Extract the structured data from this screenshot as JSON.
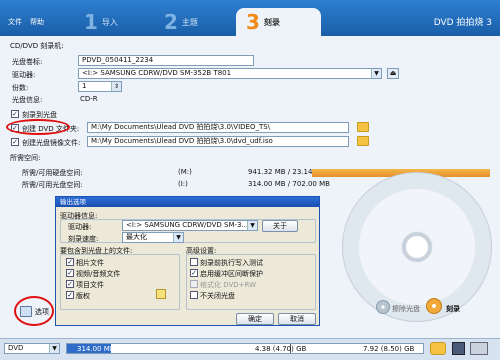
{
  "menu": {
    "file": "文件",
    "help": "帮助"
  },
  "tabs": [
    {
      "num": "1",
      "label": "导入"
    },
    {
      "num": "2",
      "label": "主题"
    },
    {
      "num": "3",
      "label": "刻录"
    }
  ],
  "app_title": "DVD 拍拍烧 3",
  "burner": {
    "section_title": "CD/DVD 刻录机:",
    "volume_label": "光盘卷标:",
    "volume_value": "PDVD_050411_2234",
    "drive_label": "驱动器:",
    "drive_value": "<I:> SAMSUNG CDRW/DVD SM-352B T801",
    "copies_label": "份数:",
    "copies_value": "1",
    "disc_info_label": "光盘信息:",
    "disc_info_value": "CD-R"
  },
  "options": {
    "burn_to_disc": "刻录到光盘",
    "create_dvd_folder": "创建 DVD 文件夹:",
    "dvd_folder_path": "M:\\My Documents\\Ulead DVD 拍拍烧\\3.0\\VIDEO_TS\\",
    "create_image": "创建光盘镜像文件:",
    "image_path": "M:\\My Documents\\Ulead DVD 拍拍烧\\3.0\\dvd_udf.iso"
  },
  "space": {
    "title": "所需空间:",
    "hdd_label": "所需/可用硬盘空间:",
    "hdd_drive": "(M:)",
    "hdd_value": "941.32 MB / 23.14 GB",
    "disc_label": "所需/可用光盘空间:",
    "disc_drive": "(I:)",
    "disc_value": "314.00 MB / 702.00 MB"
  },
  "dialog": {
    "title": "输出选项",
    "drive_info": "驱动器信息:",
    "drive_label": "驱动器:",
    "drive_value": "<I:> SAMSUNG CDRW/DVD SM-3...",
    "about_button": "关于",
    "speed_label": "刻录速度:",
    "speed_value": "最大化",
    "files_group": "要包含到光盘上的文件:",
    "files": [
      "相片文件",
      "视频/音频文件",
      "项目文件",
      "版权"
    ],
    "advanced_group": "高级设置:",
    "advanced": [
      "刻录前执行写入测试",
      "启用缓冲区间断保护",
      "格式化 DVD+RW",
      "不关闭光盘"
    ],
    "ok_button": "确定",
    "cancel_button": "取消"
  },
  "side": {
    "options_button": "选项"
  },
  "actions": {
    "erase": "擦除光盘",
    "burn": "刻录"
  },
  "bottom": {
    "disc_type": "DVD",
    "used": "314.00 MB",
    "capacity_mid": "4.38 (4.70) GB",
    "capacity_end": "7.92 (8.50) GB"
  }
}
